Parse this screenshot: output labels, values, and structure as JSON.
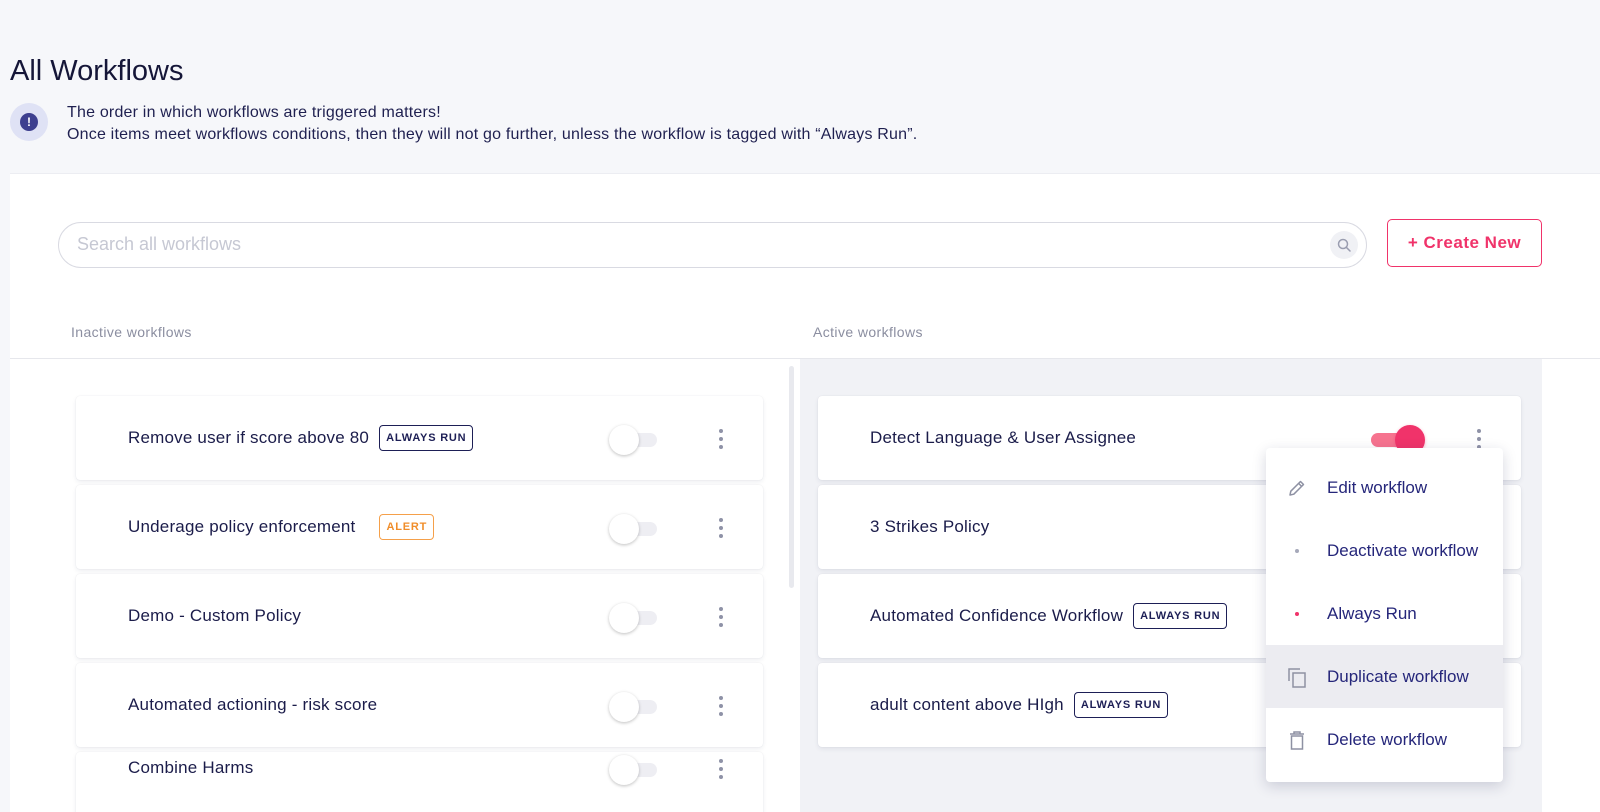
{
  "page": {
    "title": "All Workflows",
    "notice_line1": "The order in which workflows are triggered matters!",
    "notice_line2": "Once items meet workflows conditions, then they will not go further, unless the workflow is tagged with “Always Run”."
  },
  "search": {
    "placeholder": "Search all workflows"
  },
  "create_button": "+ Create New",
  "columns": {
    "inactive_label": "Inactive workflows",
    "active_label": "Active workflows"
  },
  "inactive_workflows": [
    {
      "name": "Remove user if score above 80",
      "badge": "ALWAYS RUN",
      "enabled": false
    },
    {
      "name": "Underage policy enforcement",
      "badge": "ALERT",
      "enabled": false
    },
    {
      "name": "Demo - Custom Policy",
      "badge": "",
      "enabled": false
    },
    {
      "name": "Automated actioning - risk score",
      "badge": "",
      "enabled": false
    },
    {
      "name": "Combine Harms",
      "badge": "",
      "enabled": false
    }
  ],
  "active_workflows": [
    {
      "name": "Detect Language & User Assignee",
      "badge": "",
      "enabled": true
    },
    {
      "name": "3 Strikes Policy",
      "badge": "",
      "enabled": true
    },
    {
      "name": "Automated Confidence Workflow",
      "badge": "ALWAYS RUN",
      "enabled": true
    },
    {
      "name": "adult content above HIgh",
      "badge": "ALWAYS RUN",
      "enabled": true
    }
  ],
  "context_menu": {
    "items": [
      {
        "label": "Edit workflow",
        "icon": "pencil-icon"
      },
      {
        "label": "Deactivate workflow",
        "icon": "grey-dot-icon"
      },
      {
        "label": "Always Run",
        "icon": "pink-dot-icon"
      },
      {
        "label": "Duplicate workflow",
        "icon": "copy-icon"
      },
      {
        "label": "Delete workflow",
        "icon": "trash-icon"
      }
    ]
  },
  "colors": {
    "accent": "#f0336a",
    "navy": "#1b1c4a",
    "menu_text": "#25267a",
    "alert": "#f08d2a"
  }
}
